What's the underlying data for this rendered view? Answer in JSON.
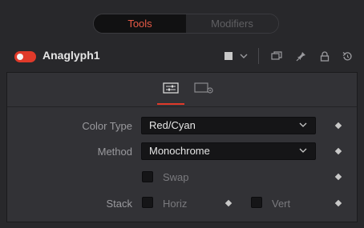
{
  "tabs": [
    {
      "label": "Tools",
      "active": true
    },
    {
      "label": "Modifiers",
      "active": false
    }
  ],
  "node": {
    "name": "Anaglyph1",
    "enabled": true,
    "header_icons": [
      "color-swatch-icon",
      "chevron-down-icon",
      "overlap-windows-icon",
      "pin-icon",
      "lock-icon",
      "reset-icon"
    ]
  },
  "subtabs": [
    {
      "icon": "sliders-icon",
      "active": true
    },
    {
      "icon": "settings-panel-icon",
      "active": false
    }
  ],
  "controls": {
    "color_type": {
      "label": "Color Type",
      "value": "Red/Cyan"
    },
    "method": {
      "label": "Method",
      "value": "Monochrome"
    },
    "swap": {
      "label": "Swap",
      "checked": false
    },
    "stack": {
      "label": "Stack",
      "horiz_label": "Horiz",
      "vert_label": "Vert",
      "horiz": false,
      "vert": false
    }
  },
  "colors": {
    "accent": "#e03a2a",
    "active_tab_text": "#e85a46",
    "background": "#28282b",
    "panel": "#323236"
  }
}
